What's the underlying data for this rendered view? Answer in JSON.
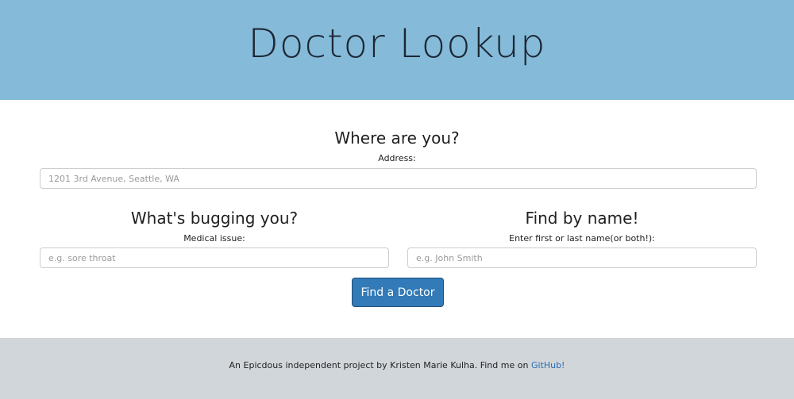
{
  "header": {
    "title": "Doctor Lookup"
  },
  "location": {
    "heading": "Where are you?",
    "label": "Address:",
    "placeholder": "1201 3rd Avenue, Seattle, WA",
    "value": ""
  },
  "issue": {
    "heading": "What's bugging you?",
    "label": "Medical issue:",
    "placeholder": "e.g. sore throat",
    "value": ""
  },
  "name": {
    "heading": "Find by name!",
    "label": "Enter first or last name(or both!):",
    "placeholder": "e.g. John Smith",
    "value": ""
  },
  "submit": {
    "label": "Find a Doctor"
  },
  "footer": {
    "text": "An Epicdous independent project by Kristen Marie Kulha. Find me on ",
    "link_label": "GitHub!"
  },
  "colors": {
    "header_bg": "#85bad9",
    "button_bg": "#327ab8",
    "footer_bg": "#d1d6da",
    "link": "#2a6db3"
  }
}
